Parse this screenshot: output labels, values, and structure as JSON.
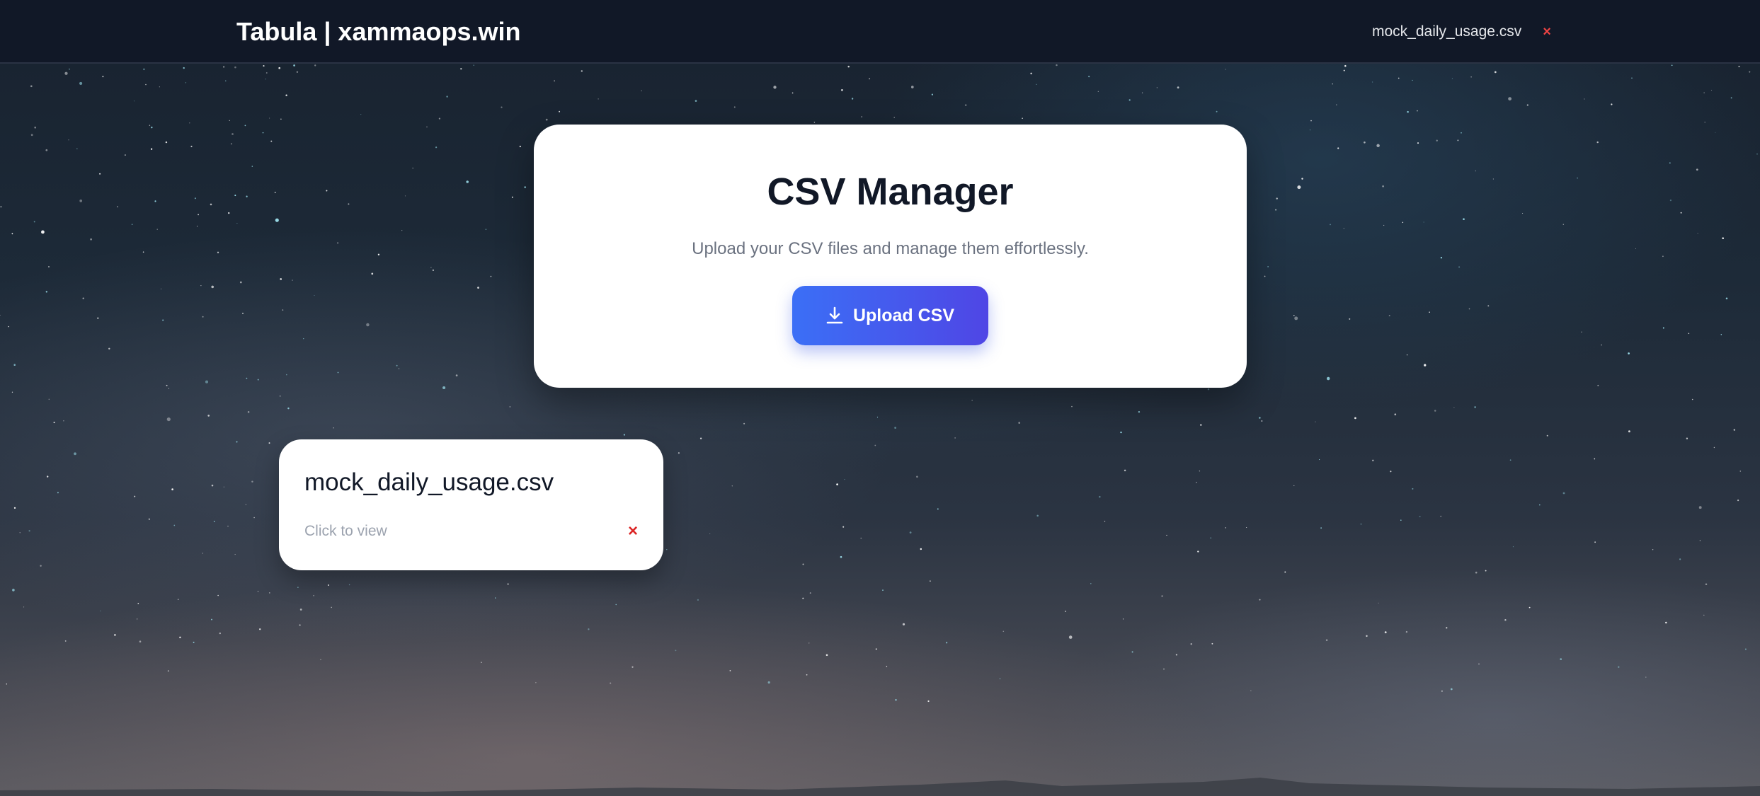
{
  "header": {
    "brand": "Tabula | xammaops.win",
    "open_file": {
      "label": "mock_daily_usage.csv",
      "close_symbol": "×",
      "close_color": "#ef4444"
    },
    "background_color": "#111827"
  },
  "hero": {
    "title": "CSV Manager",
    "subtitle": "Upload your CSV files and manage them effortlessly.",
    "upload_button": {
      "label": "Upload CSV",
      "icon": "download-arrow-icon",
      "gradient_start": "#3b6ff6",
      "gradient_end": "#4f46e5"
    }
  },
  "files": [
    {
      "name": "mock_daily_usage.csv",
      "hint": "Click to view",
      "delete_symbol": "×",
      "delete_color": "#dc2626"
    }
  ],
  "background": {
    "theme": "starry night sky"
  }
}
